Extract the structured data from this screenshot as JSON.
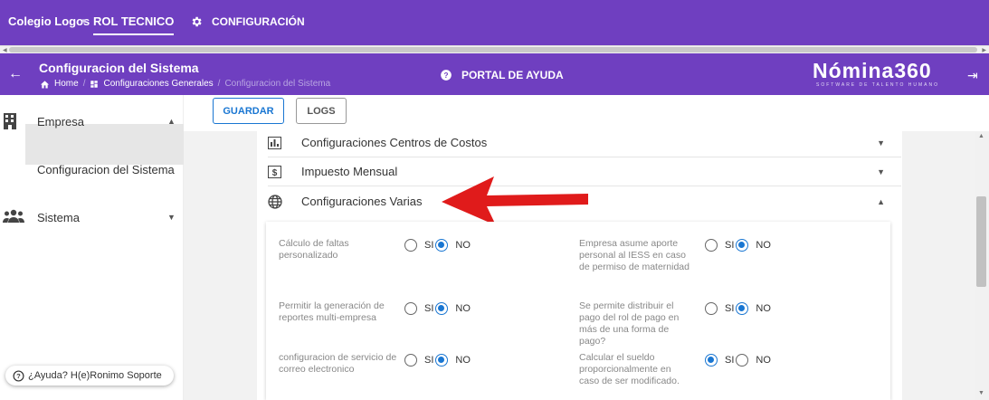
{
  "topbar": {
    "school": "Colegio Logos",
    "role_tab": "ROL TECNICO",
    "config_label": "CONFIGURACIÓN"
  },
  "header": {
    "title": "Configuracion del Sistema",
    "breadcrumb": [
      "Home",
      "Configuraciones Generales",
      "Configuracion del Sistema"
    ],
    "help_label": "PORTAL DE AYUDA",
    "brand": "Nómina360",
    "brand_sub": "SOFTWARE DE TALENTO HUMANO"
  },
  "sidebar": {
    "items": [
      {
        "label": "Empresa",
        "icon": "building-icon",
        "expanded": true
      },
      {
        "label": "Configuracion del Sistema",
        "selected": true
      },
      {
        "label": "Sistema",
        "icon": "users-icon",
        "expanded": false
      }
    ],
    "help_pill": "¿Ayuda? H(e)Ronimo Soporte"
  },
  "toolbar": {
    "save_label": "GUARDAR",
    "logs_label": "LOGS"
  },
  "sections": [
    {
      "label": "Configuraciones Centros de Costos",
      "icon": "bar-chart-icon",
      "expanded": false
    },
    {
      "label": "Impuesto Mensual",
      "icon": "dollar-icon",
      "expanded": false
    },
    {
      "label": "Configuraciones Varias",
      "icon": "globe-icon",
      "expanded": true
    }
  ],
  "options": {
    "si": "SI",
    "no": "NO",
    "items": [
      {
        "label": "Cálculo de faltas personalizado",
        "selected": "NO"
      },
      {
        "label": "Empresa asume aporte personal al IESS en caso de permiso de maternidad",
        "selected": "NO"
      },
      {
        "label": "Permitir la generación de reportes multi-empresa",
        "selected": "NO"
      },
      {
        "label": "Se permite distribuir el pago del rol de pago en más de una forma de pago?",
        "selected": "NO"
      },
      {
        "label": "configuracion de servicio de correo electronico",
        "selected": "NO"
      },
      {
        "label": "Calcular el sueldo proporcionalmente en caso de ser modificado.",
        "selected": "SI"
      }
    ]
  },
  "colors": {
    "primary": "#6f3fc0",
    "radio_selected": "#1976d2",
    "arrow": "#e01b1b"
  }
}
